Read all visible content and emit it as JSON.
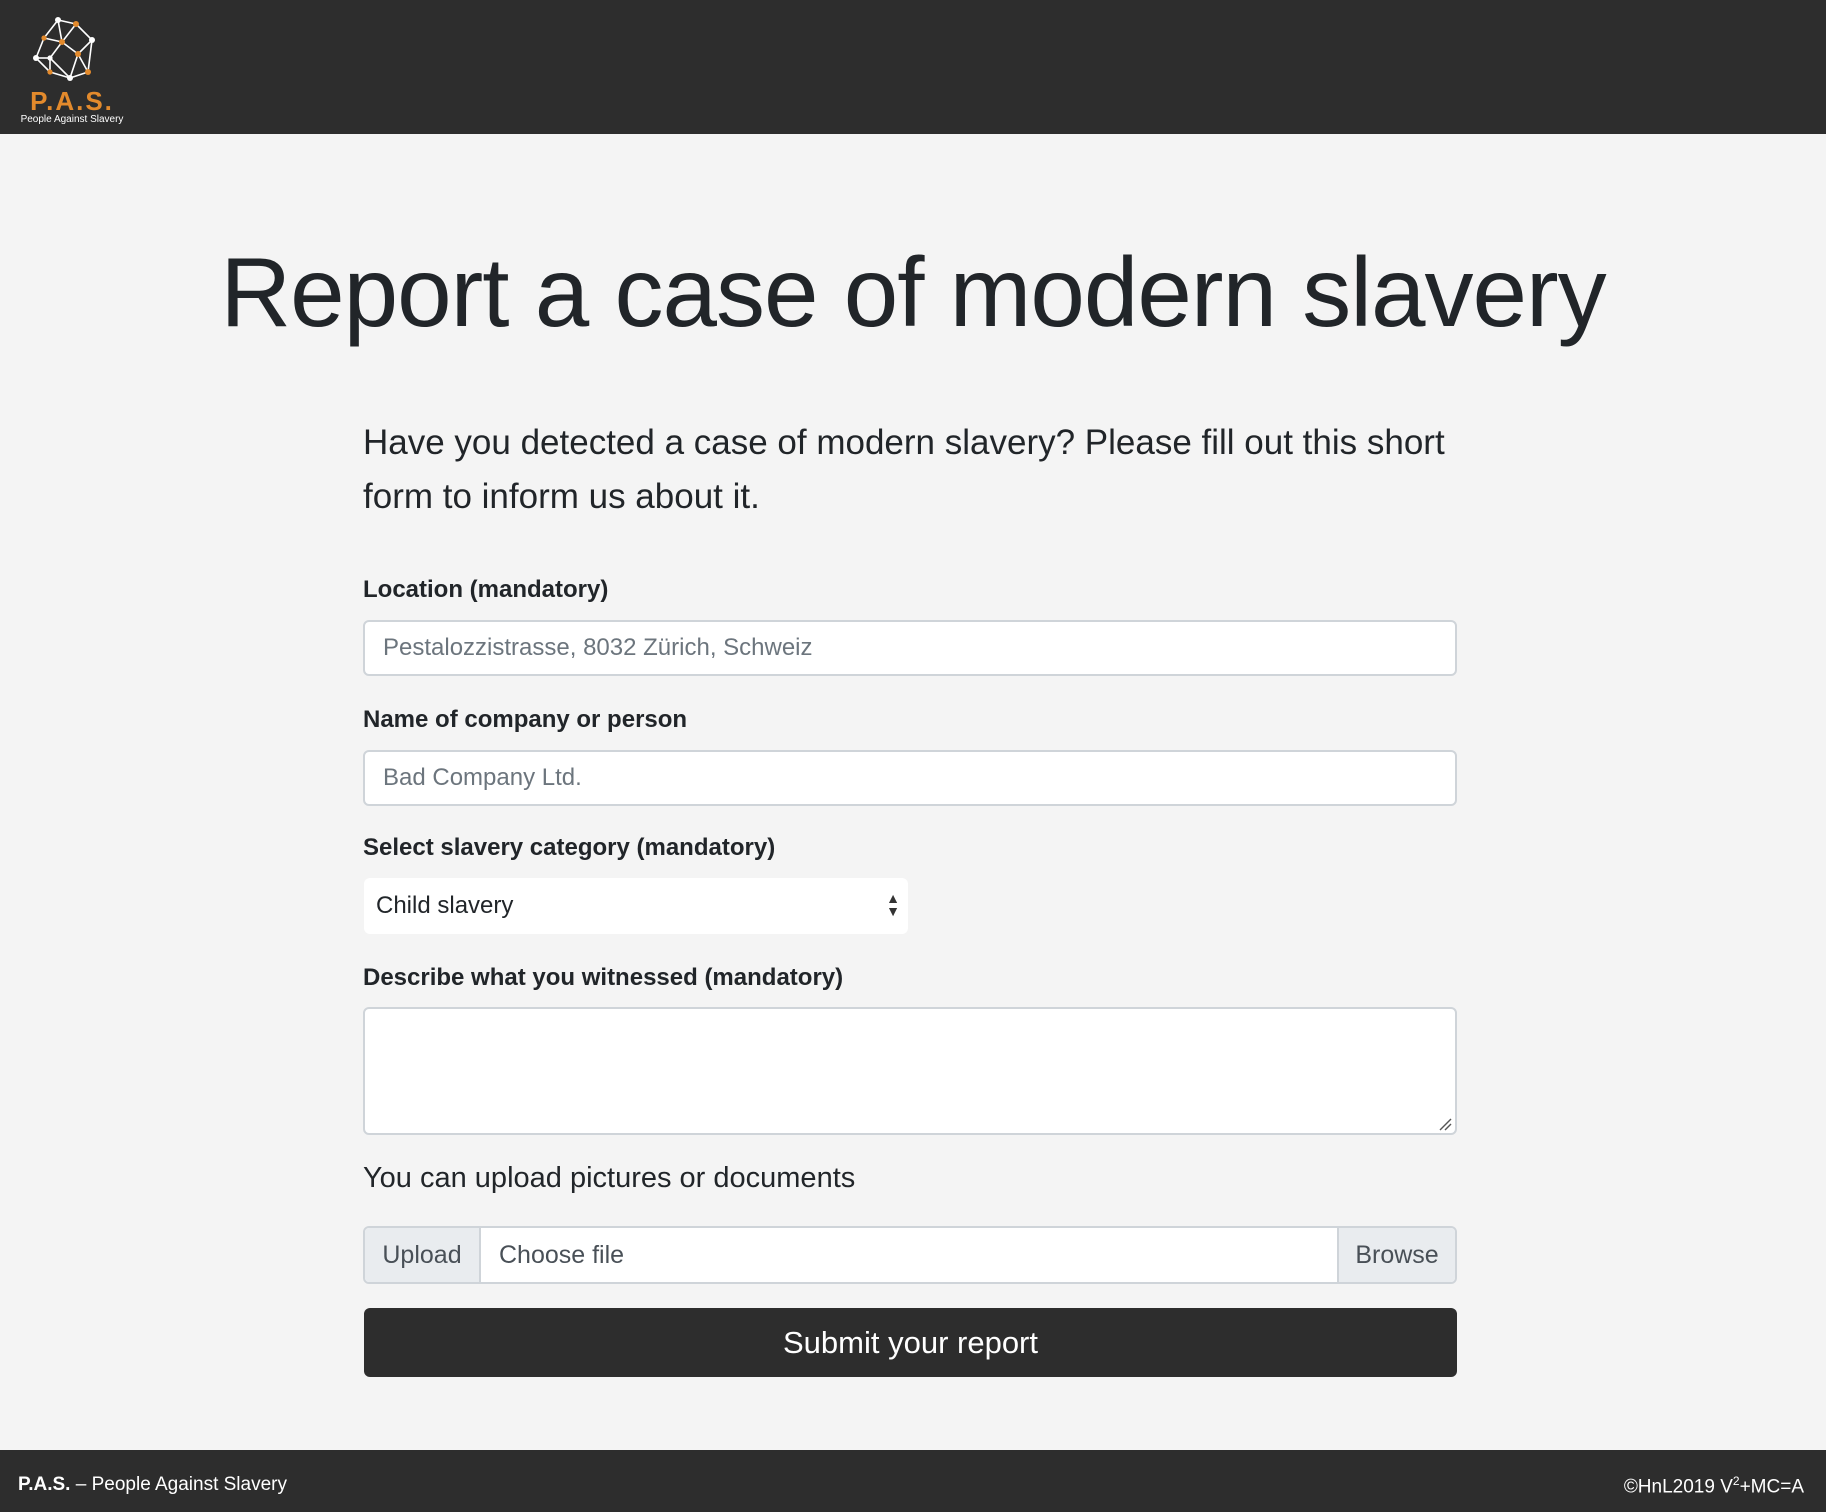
{
  "header": {
    "logo_abbr": "P.A.S.",
    "logo_full": "People Against Slavery"
  },
  "main": {
    "title": "Report a case of modern slavery",
    "lead": "Have you detected a case of modern slavery? Please fill out this short form to inform us about it."
  },
  "form": {
    "location": {
      "label": "Location (mandatory)",
      "value": "",
      "placeholder": "Pestalozzistrasse, 8032 Zürich, Schweiz"
    },
    "company": {
      "label": "Name of company or person",
      "value": "",
      "placeholder": "Bad Company Ltd."
    },
    "category": {
      "label": "Select slavery category (mandatory)",
      "selected": "Child slavery"
    },
    "description": {
      "label": "Describe what you witnessed (mandatory)",
      "value": ""
    },
    "upload": {
      "note": "You can upload pictures or documents",
      "prepend_label": "Upload",
      "file_label": "Choose file",
      "browse_label": "Browse"
    },
    "submit_label": "Submit your report"
  },
  "footer": {
    "brand": "P.A.S.",
    "tagline": " – People Against Slavery",
    "copyright_prefix": "©HnL2019 V",
    "copyright_sup": "2",
    "copyright_suffix": "+MC=A"
  },
  "colors": {
    "bar": "#2d2d2d",
    "accent": "#e38a2c",
    "background": "#f4f4f4"
  }
}
